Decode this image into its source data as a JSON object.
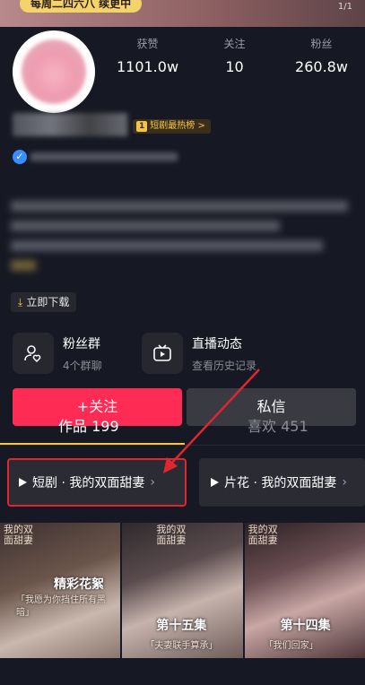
{
  "banner": {
    "pill_text": "每周二四六八 续更中",
    "page_indicator": "1/1"
  },
  "stats": [
    {
      "label": "获赞",
      "value": "1101.0w"
    },
    {
      "label": "关注",
      "value": "10"
    },
    {
      "label": "粉丝",
      "value": "260.8w"
    }
  ],
  "profile": {
    "rank_num": "1",
    "rank_tag": "短剧最热榜 >",
    "download_label": "立即下载"
  },
  "features": [
    {
      "title": "粉丝群",
      "subtitle": "4个群聊",
      "icon": "fan-group-icon"
    },
    {
      "title": "直播动态",
      "subtitle": "查看历史记录",
      "icon": "live-tv-icon"
    }
  ],
  "actions": {
    "follow_label": "+关注",
    "message_label": "私信"
  },
  "tabs": [
    {
      "label": "作品 199",
      "active": true
    },
    {
      "label": "喜欢 451",
      "active": false
    }
  ],
  "chips": [
    {
      "label": "短剧 · 我的双面甜妻",
      "highlighted": true
    },
    {
      "label": "片花 · 我的双面甜妻",
      "highlighted": false
    }
  ],
  "thumbnails": [
    {
      "show_title": "我的双面甜妻",
      "caption": "精彩花絮",
      "subtitle": "「我愿为你挡住所有黑暗」"
    },
    {
      "show_title": "我的双面甜妻",
      "caption": "第十五集",
      "subtitle": "「夫妻联手算承」"
    },
    {
      "show_title": "我的双面甜妻",
      "caption": "第十四集",
      "subtitle": "「我们回家」"
    }
  ],
  "colors": {
    "background": "#161823",
    "follow": "#fe2c55",
    "accent_gold": "#f5c442",
    "highlight_red": "#e0262f"
  }
}
